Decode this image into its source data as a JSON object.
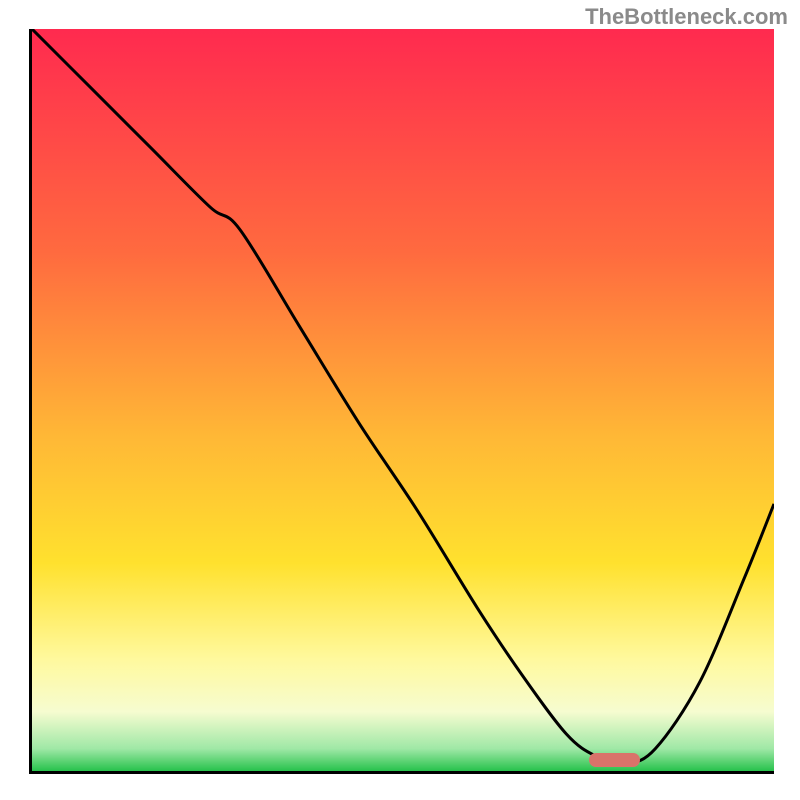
{
  "watermark": "TheBottleneck.com",
  "chart_data": {
    "type": "line",
    "title": "",
    "xlabel": "",
    "ylabel": "",
    "xlim": [
      0,
      100
    ],
    "ylim": [
      0,
      100
    ],
    "gradient_stops": [
      {
        "offset": 0,
        "color": "#ff2a4f"
      },
      {
        "offset": 30,
        "color": "#ff6a3f"
      },
      {
        "offset": 55,
        "color": "#ffb836"
      },
      {
        "offset": 72,
        "color": "#ffe12e"
      },
      {
        "offset": 85,
        "color": "#fff99e"
      },
      {
        "offset": 92,
        "color": "#f6fcd0"
      },
      {
        "offset": 97,
        "color": "#9fe8a6"
      },
      {
        "offset": 100,
        "color": "#27c24c"
      }
    ],
    "series": [
      {
        "name": "bottleneck-curve",
        "x": [
          0,
          8,
          16,
          24,
          28,
          36,
          44,
          52,
          60,
          66,
          72,
          76,
          80,
          84,
          90,
          96,
          100
        ],
        "y": [
          100,
          92,
          84,
          76,
          73,
          60,
          47,
          35,
          22,
          13,
          5,
          2,
          1,
          3,
          12,
          26,
          36
        ]
      }
    ],
    "marker": {
      "x_start": 75,
      "x_end": 82,
      "y": 1.5,
      "color": "#d9736a"
    }
  }
}
